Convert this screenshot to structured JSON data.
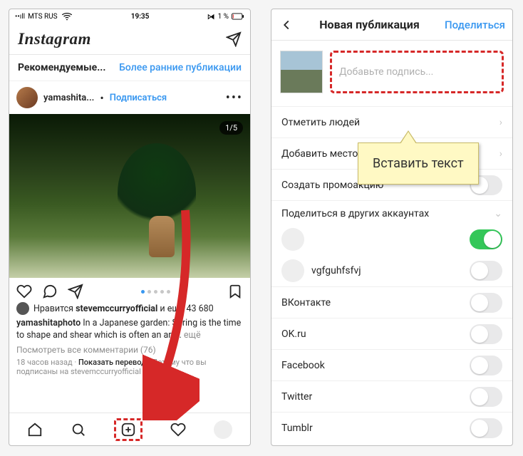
{
  "left": {
    "status": {
      "carrier": "MTS RUS",
      "time": "19:35",
      "battery": "1 %"
    },
    "logo": "Instagram",
    "recommend": {
      "title": "Рекомендуемые...",
      "link": "Более ранние публикации"
    },
    "post": {
      "user": "yamashita...",
      "follow": "Подписаться",
      "counter": "1/5",
      "likes_prefix": "Нравится",
      "likes_user": "stevemccurryofficial",
      "likes_suffix": "и ещё 43 680",
      "caption_user": "yamashitaphoto",
      "caption_text": "In a Japanese garden: Spring is the time to shape and shear which is often an art...",
      "more": "ещё",
      "comments": "Посмотреть все комментарии (76)",
      "time": "18 часов назад",
      "translate": "Показать перевод",
      "reason": "Потому что вы подписаны на stevemccurryofficial"
    }
  },
  "right": {
    "nav": {
      "title": "Новая публикация",
      "share": "Поделиться"
    },
    "caption_placeholder": "Добавьте подпись...",
    "rows": {
      "tag_people": "Отметить людей",
      "add_place": "Добавить место",
      "create_promo": "Создать промоакцию"
    },
    "share_section": "Поделиться в других аккаунтах",
    "accounts": [
      {
        "name": "",
        "on": true
      },
      {
        "name": "vgfguhfsfvj",
        "on": false
      }
    ],
    "networks": [
      "ВКонтакте",
      "OK.ru",
      "Facebook",
      "Twitter",
      "Tumblr"
    ]
  },
  "callout": "Вставить текст"
}
